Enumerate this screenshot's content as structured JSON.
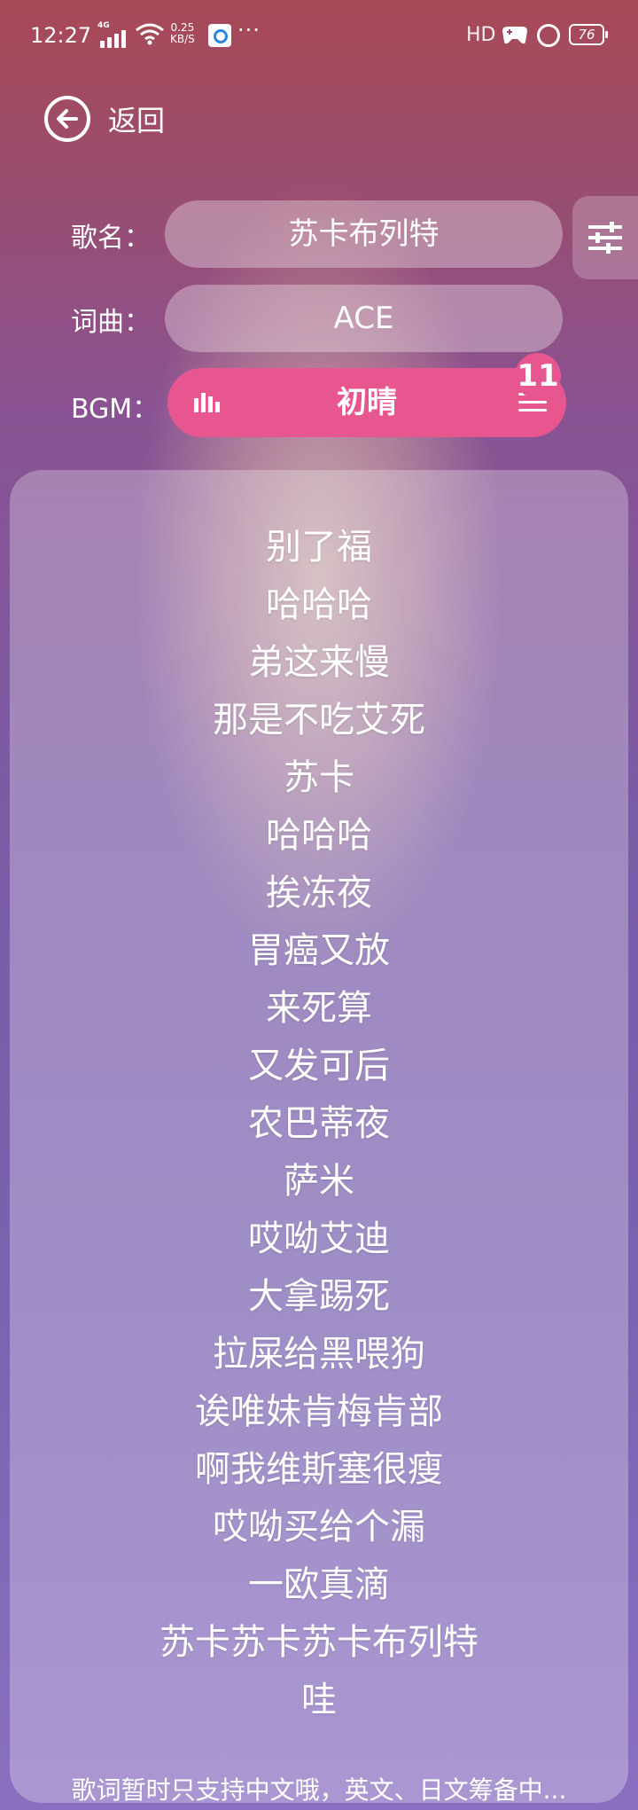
{
  "status_bar": {
    "time": "12:27",
    "network": "4G",
    "speed_value": "0.25",
    "speed_unit": "KB/S",
    "more": "···",
    "hd": "HD",
    "battery": "76"
  },
  "back": {
    "label": "返回"
  },
  "song": {
    "label": "歌名：",
    "value": "苏卡布列特"
  },
  "composer": {
    "label": "词曲：",
    "value": "ACE"
  },
  "bgm": {
    "label": "BGM：",
    "value": "初晴",
    "badge": "11"
  },
  "lyrics": [
    "别了福",
    "哈哈哈",
    "弟这来慢",
    "那是不吃艾死",
    "苏卡",
    "哈哈哈",
    "挨冻夜",
    "胃癌又放",
    "来死算",
    "又发可后",
    "农巴蒂夜",
    "萨米",
    "哎呦艾迪",
    "大拿踢死",
    "拉屎给黑喂狗",
    "诶唯妹肯梅肯部",
    "啊我维斯塞很瘦",
    "哎呦买给个漏",
    "一欧真滴",
    "苏卡苏卡苏卡布列特",
    "哇"
  ],
  "footer_note": "歌词暂时只支持中文哦，英文、日文筹备中..."
}
